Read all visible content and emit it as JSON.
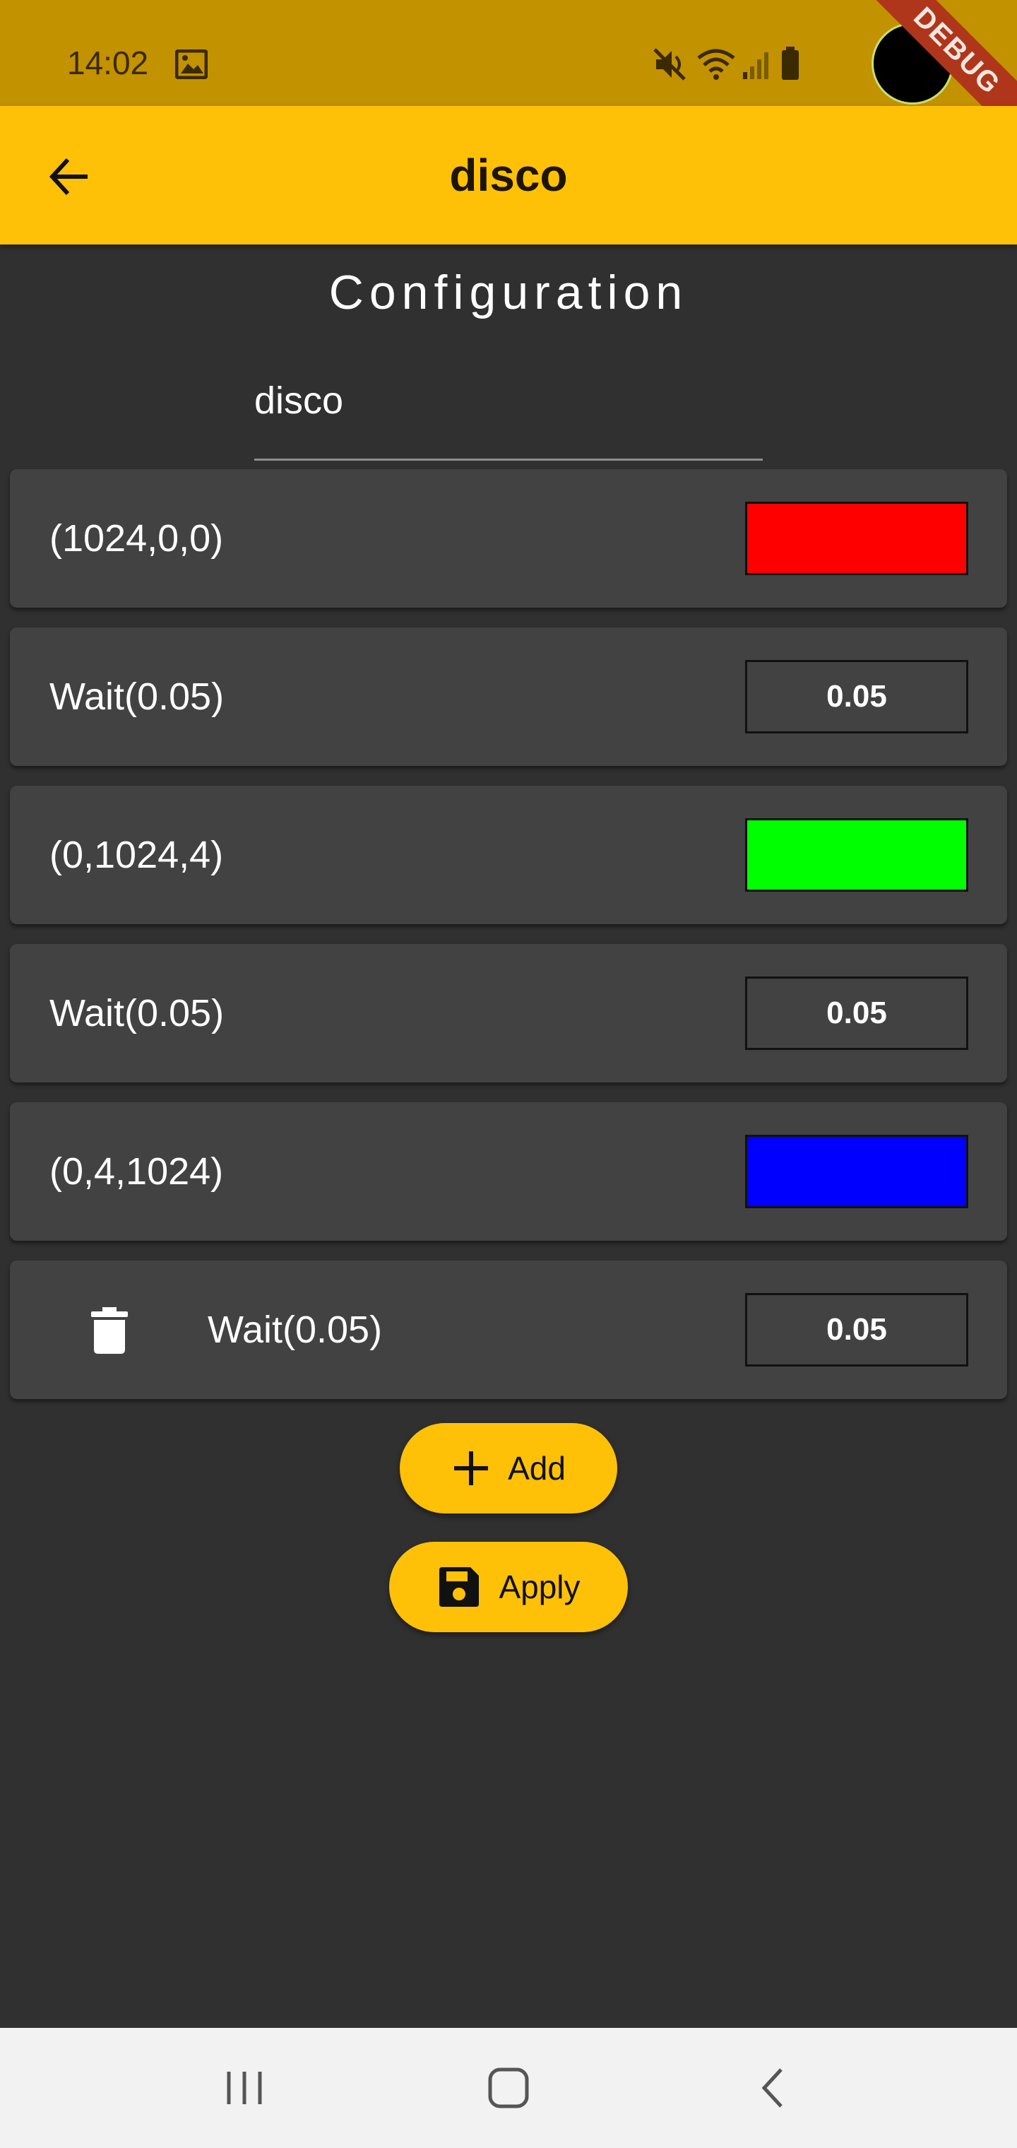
{
  "status_bar": {
    "time": "14:02",
    "icons": [
      "image-icon",
      "mute-icon",
      "wifi-icon",
      "signal-icon",
      "battery-icon"
    ],
    "debug_banner": "DEBUG"
  },
  "app_bar": {
    "title": "disco",
    "back_icon": "arrow-back-icon",
    "color": "#ffc107"
  },
  "config": {
    "heading": "Configuration",
    "name_value": "disco"
  },
  "steps": [
    {
      "label": "(1024,0,0)",
      "type": "color",
      "color": "#ff0000"
    },
    {
      "label": "Wait(0.05)",
      "type": "wait",
      "value": "0.05"
    },
    {
      "label": "(0,1024,4)",
      "type": "color",
      "color": "#00ff00"
    },
    {
      "label": "Wait(0.05)",
      "type": "wait",
      "value": "0.05"
    },
    {
      "label": "(0,4,1024)",
      "type": "color",
      "color": "#0000ff"
    },
    {
      "label": "Wait(0.05)",
      "type": "wait",
      "value": "0.05",
      "trash_icon": "delete-icon"
    }
  ],
  "actions": {
    "add_label": "Add",
    "apply_label": "Apply"
  },
  "nav": {
    "items": [
      "recent-apps-icon",
      "home-icon",
      "back-icon"
    ]
  }
}
